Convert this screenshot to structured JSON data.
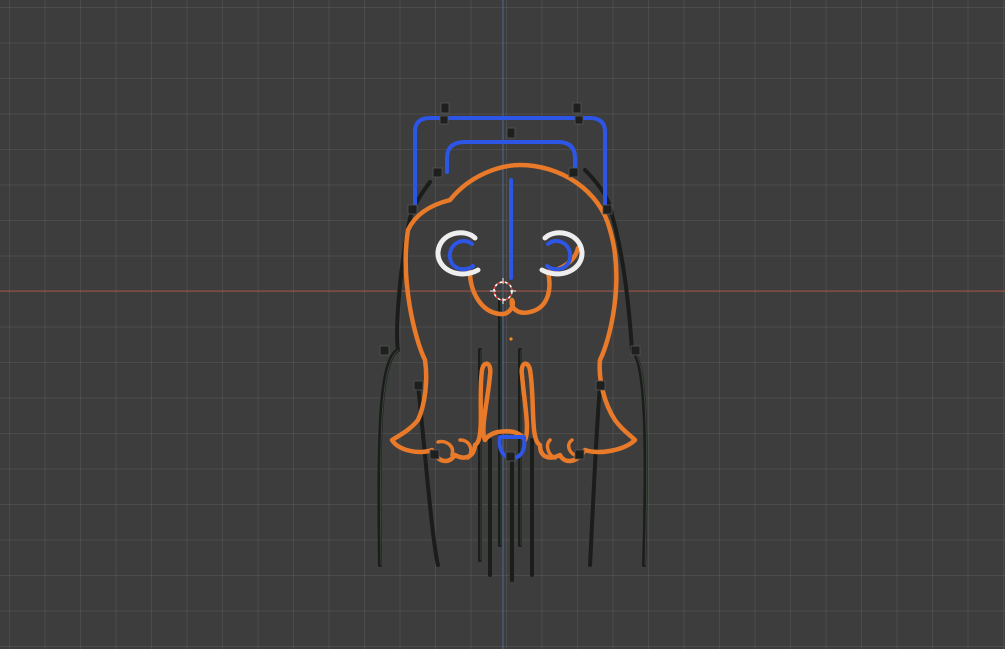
{
  "viewport": {
    "background": "#3d3d3d",
    "grid_color": "#4a4a4a",
    "x_axis_color": "#b5503f",
    "y_axis_color": "#4f6fa8"
  },
  "model": {
    "neon_orange": "#e87a2a",
    "neon_blue": "#2d55e6",
    "neon_white": "#eeeeee",
    "cable_color": "#1a1d1a",
    "cable_edge": "#3a453a"
  },
  "icons": {
    "cursor": "3d-cursor-icon",
    "origin": "origin-point-icon"
  }
}
